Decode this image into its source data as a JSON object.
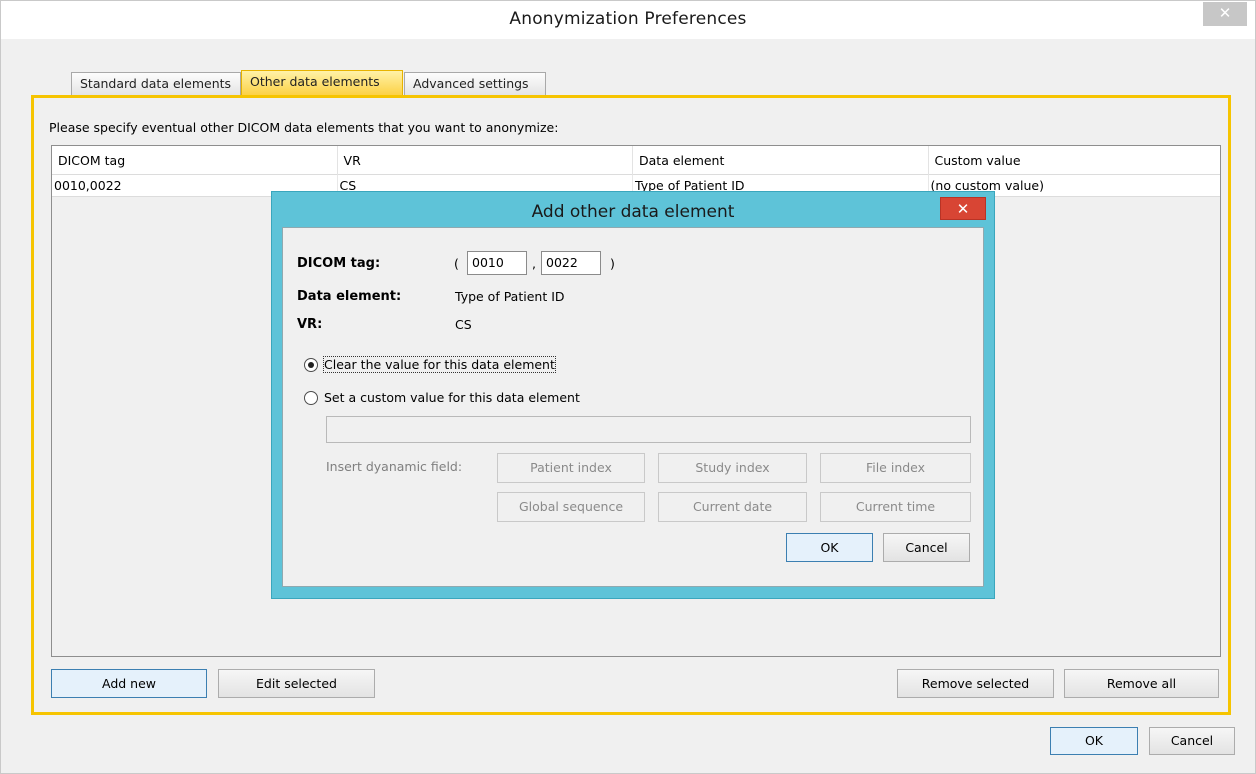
{
  "window": {
    "title": "Anonymization Preferences",
    "close_icon": "close-icon"
  },
  "tabs": [
    {
      "label": "Standard data elements",
      "active": false
    },
    {
      "label": "Other data elements",
      "active": true
    },
    {
      "label": "Advanced settings",
      "active": false
    }
  ],
  "panel": {
    "instruction": "Please specify eventual other DICOM data elements that you want to anonymize:",
    "table": {
      "columns": [
        "DICOM tag",
        "VR",
        "Data element",
        "Custom value"
      ],
      "rows": [
        [
          "0010,0022",
          "CS",
          "Type of Patient ID",
          "(no custom value)"
        ]
      ]
    },
    "buttons": {
      "add_new": "Add new",
      "edit_selected": "Edit selected",
      "remove_selected": "Remove selected",
      "remove_all": "Remove all"
    }
  },
  "footer": {
    "ok": "OK",
    "cancel": "Cancel"
  },
  "dialog": {
    "title": "Add other data element",
    "dicom_tag_label": "DICOM tag:",
    "tag_open": "(",
    "tag_comma": ",",
    "tag_close": ")",
    "tag_group": "0010",
    "tag_element": "0022",
    "data_element_label": "Data element:",
    "data_element_value": "Type of Patient ID",
    "vr_label": "VR:",
    "vr_value": "CS",
    "radio_clear": "Clear the value for this data element",
    "radio_custom": "Set a custom value for this data element",
    "custom_value": "",
    "insert_label": "Insert dyanamic field:",
    "dynamic_fields": [
      "Patient index",
      "Study index",
      "File index",
      "Global sequence",
      "Current date",
      "Current time"
    ],
    "ok": "OK",
    "cancel": "Cancel",
    "selected_option": "clear"
  },
  "colors": {
    "tab_active": "#fcd042",
    "panel_border": "#f6c400",
    "dialog_frame": "#5ec3d8",
    "dialog_close": "#d84534",
    "primary_button": "#e5f1fb"
  }
}
